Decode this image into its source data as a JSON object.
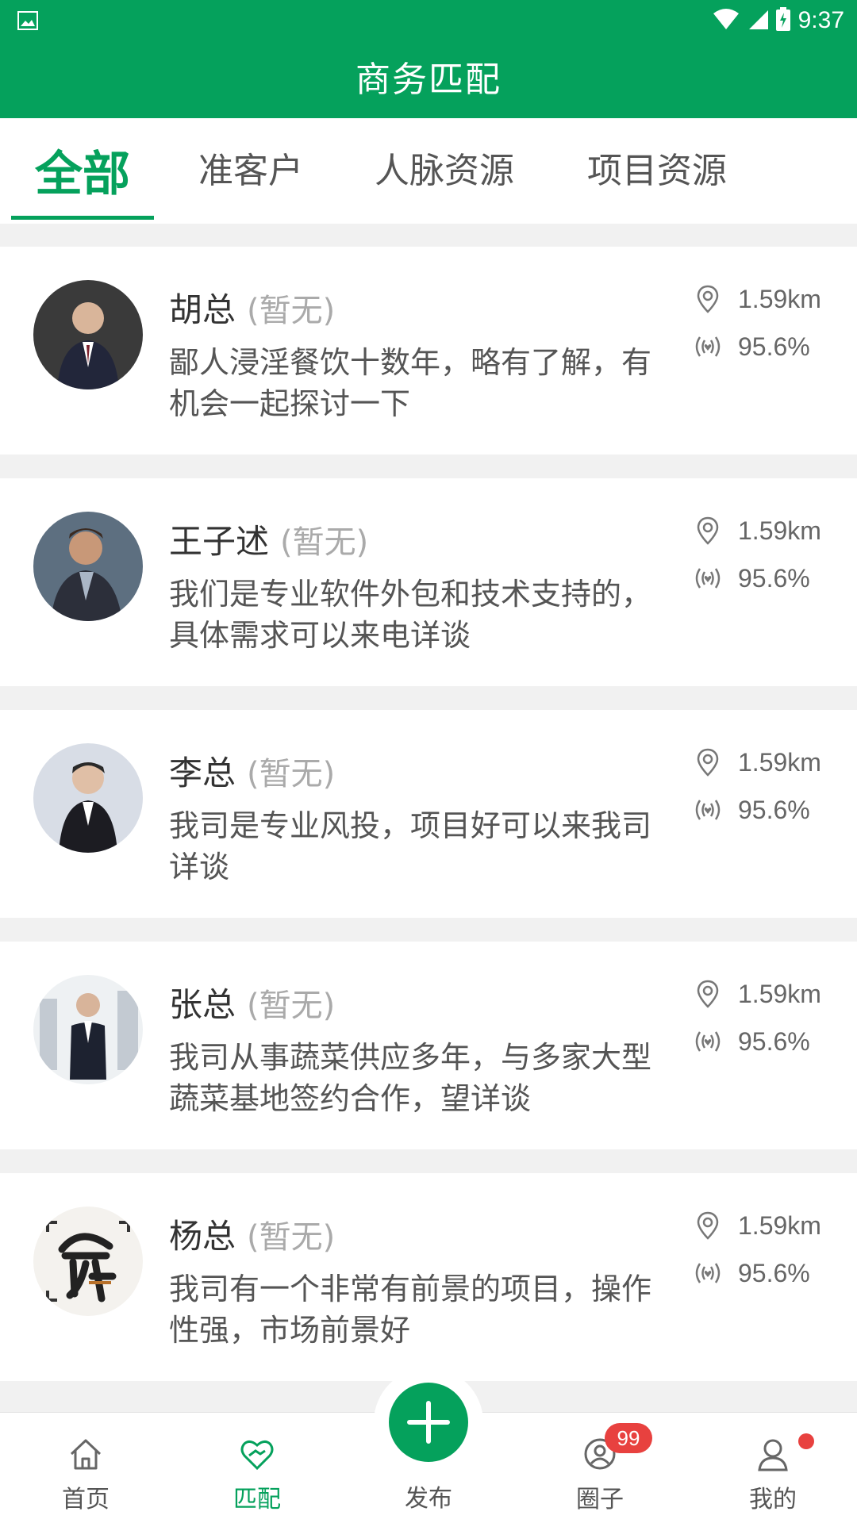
{
  "status_bar": {
    "time": "9:37"
  },
  "header": {
    "title": "商务匹配"
  },
  "tabs": [
    {
      "label": "全部",
      "active": true
    },
    {
      "label": "准客户",
      "active": false
    },
    {
      "label": "人脉资源",
      "active": false
    },
    {
      "label": "项目资源",
      "active": false
    }
  ],
  "cards": [
    {
      "name": "胡总",
      "tag": "(暂无)",
      "desc": "鄙人浸淫餐饮十数年，略有了解，有机会一起探讨一下",
      "distance": "1.59km",
      "match": "95.6%"
    },
    {
      "name": "王子述",
      "tag": "(暂无)",
      "desc": "我们是专业软件外包和技术支持的，具体需求可以来电详谈",
      "distance": "1.59km",
      "match": "95.6%"
    },
    {
      "name": "李总",
      "tag": "(暂无)",
      "desc": "我司是专业风投，项目好可以来我司详谈",
      "distance": "1.59km",
      "match": "95.6%"
    },
    {
      "name": "张总",
      "tag": "(暂无)",
      "desc": "我司从事蔬菜供应多年，与多家大型蔬菜基地签约合作，望详谈",
      "distance": "1.59km",
      "match": "95.6%"
    },
    {
      "name": "杨总",
      "tag": "(暂无)",
      "desc": "我司有一个非常有前景的项目，操作性强，市场前景好",
      "distance": "1.59km",
      "match": "95.6%"
    }
  ],
  "bottom_nav": {
    "home": "首页",
    "match": "匹配",
    "publish": "发布",
    "circle": "圈子",
    "circle_badge": "99",
    "mine": "我的"
  },
  "colors": {
    "brand": "#05a15c",
    "badge": "#e8413f"
  }
}
